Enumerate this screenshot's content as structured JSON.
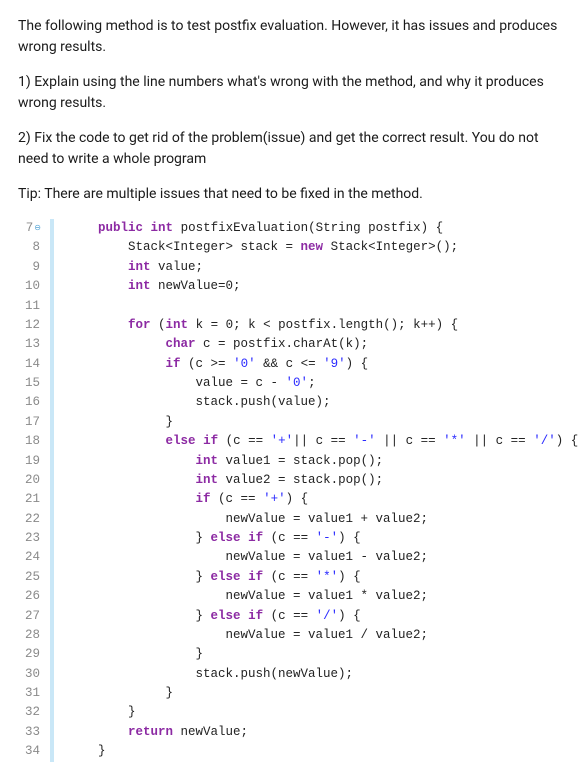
{
  "intro": "The following method is to test postfix evaluation. However, it has issues and produces wrong results.",
  "q1": "1) Explain using the line numbers what's wrong with the method, and why it produces wrong results.",
  "q2": "2) Fix the code to get rid of the problem(issue) and get the correct result. You do not need to write a whole program",
  "tip": "Tip: There are multiple issues that need to be fixed in the method.",
  "lines": {
    "l7": "7",
    "l8": "8",
    "l9": "9",
    "l10": "10",
    "l11": "11",
    "l12": "12",
    "l13": "13",
    "l14": "14",
    "l15": "15",
    "l16": "16",
    "l17": "17",
    "l18": "18",
    "l19": "19",
    "l20": "20",
    "l21": "21",
    "l22": "22",
    "l23": "23",
    "l24": "24",
    "l25": "25",
    "l26": "26",
    "l27": "27",
    "l28": "28",
    "l29": "29",
    "l30": "30",
    "l31": "31",
    "l32": "32",
    "l33": "33",
    "l34": "34"
  },
  "code": {
    "kw_public": "public",
    "kw_int": "int",
    "kw_new": "new",
    "kw_char": "char",
    "kw_for": "for",
    "kw_if": "if",
    "kw_else": "else",
    "kw_return": "return",
    "fn_name": "postfixEvaluation",
    "param": "(String postfix) {",
    "l8": "        Stack<Integer> stack = ",
    "l8b": " Stack<Integer>();",
    "l9": " value;",
    "l10": " newValue=0;",
    "l12a": " (",
    "l12b": " k = 0; k < postfix.length(); k++) {",
    "l13": " c = postfix.charAt(k);",
    "l14a": " (c >= ",
    "c0": "'0'",
    "l14b": " && c <= ",
    "c9": "'9'",
    "l14c": ") {",
    "l15a": "                 value = c - ",
    "l15b": ";",
    "l16": "                 stack.push(value);",
    "l17": "             }",
    "l18a": " (c == ",
    "cplus": "'+'",
    "l18b": "|| c == ",
    "cminus": "'-'",
    "l18c": " || c == ",
    "cstar": "'*'",
    "l18d": " || c == ",
    "cslash": "'/'",
    "l18e": ") {",
    "l19": " value1 = stack.pop();",
    "l20": " value2 = stack.pop();",
    "l21a": " (c == ",
    "l21b": ") {",
    "l22": "                     newValue = value1 + value2;",
    "l23a": "                 } ",
    "l23b": " (c == ",
    "l23c": ") {",
    "l24": "                     newValue = value1 - value2;",
    "l25c": ") {",
    "l26": "                     newValue = value1 * value2;",
    "l27c": ") {",
    "l28": "                     newValue = value1 / value2;",
    "l29": "                 }",
    "l30": "                 stack.push(newValue);",
    "l31": "             }",
    "l32": "        }",
    "l33": " newValue;",
    "l34": "    }",
    "pad8": "        ",
    "pad12": "             ",
    "pad16": "                 ",
    "sp": " "
  }
}
